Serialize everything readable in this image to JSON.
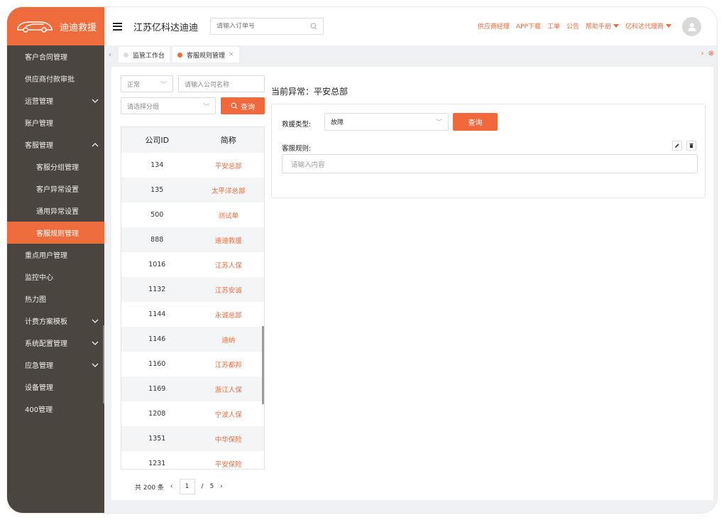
{
  "brand": {
    "name": "迪迪救援",
    "accent": "#ee6b3b",
    "sidebar_bg": "#4b4540"
  },
  "sidebar": {
    "items": [
      {
        "label": "客户合同管理",
        "expandable": false
      },
      {
        "label": "供应商付款审批",
        "expandable": false
      },
      {
        "label": "运营管理",
        "expandable": true,
        "expanded": false
      },
      {
        "label": "账户管理",
        "expandable": false
      },
      {
        "label": "客服管理",
        "expandable": true,
        "expanded": true
      },
      {
        "label": "客服分组管理",
        "sub": true
      },
      {
        "label": "客户异常设置",
        "sub": true
      },
      {
        "label": "通用异常设置",
        "sub": true
      },
      {
        "label": "客服规则管理",
        "sub": true,
        "active": true
      },
      {
        "label": "重点用户管理",
        "expandable": false
      },
      {
        "label": "监控中心",
        "expandable": false
      },
      {
        "label": "热力图",
        "expandable": false
      },
      {
        "label": "计费方案模板",
        "expandable": true,
        "expanded": false
      },
      {
        "label": "系统配置管理",
        "expandable": true,
        "expanded": false
      },
      {
        "label": "应急管理",
        "expandable": true,
        "expanded": false
      },
      {
        "label": "设备管理",
        "expandable": false
      },
      {
        "label": "400管理",
        "expandable": false
      }
    ]
  },
  "header": {
    "company": "江苏亿科达迪迪",
    "order_search_placeholder": "请输入订单号",
    "links": [
      "供应商经理",
      "APP下载",
      "工单",
      "公告"
    ],
    "help": "帮助手册",
    "agent": "亿科达代理商"
  },
  "tabs": [
    {
      "label": "监管工作台",
      "active": false
    },
    {
      "label": "客服规则管理",
      "active": true,
      "closable": "×"
    }
  ],
  "filters": {
    "status_value": "正常",
    "company_placeholder": "请输入公司名称",
    "group_placeholder": "请选择分组",
    "query_label": "查询"
  },
  "table": {
    "headers": [
      "公司ID",
      "简称"
    ],
    "rows": [
      {
        "id": "134",
        "name": "平安总部"
      },
      {
        "id": "135",
        "name": "太平洋总部"
      },
      {
        "id": "500",
        "name": "测试单"
      },
      {
        "id": "888",
        "name": "迪迪救援"
      },
      {
        "id": "1016",
        "name": "江苏人保"
      },
      {
        "id": "1132",
        "name": "江苏安诚"
      },
      {
        "id": "1144",
        "name": "永诚总部"
      },
      {
        "id": "1146",
        "name": "迪纳"
      },
      {
        "id": "1160",
        "name": "江苏都邦"
      },
      {
        "id": "1169",
        "name": "浙江人保"
      },
      {
        "id": "1208",
        "name": "宁波人保"
      },
      {
        "id": "1351",
        "name": "中华保险"
      },
      {
        "id": "1231",
        "name": "平安保险"
      }
    ]
  },
  "pager": {
    "total": "共 200 条",
    "current": "1",
    "sep": "/",
    "pages": "5"
  },
  "detail": {
    "title": "当前异常：平安总部",
    "rescue_type_label": "救援类型:",
    "rescue_type_value": "故障",
    "query_label": "查询",
    "rule_label": "客服规则:",
    "rule_placeholder": "请输入内容"
  }
}
